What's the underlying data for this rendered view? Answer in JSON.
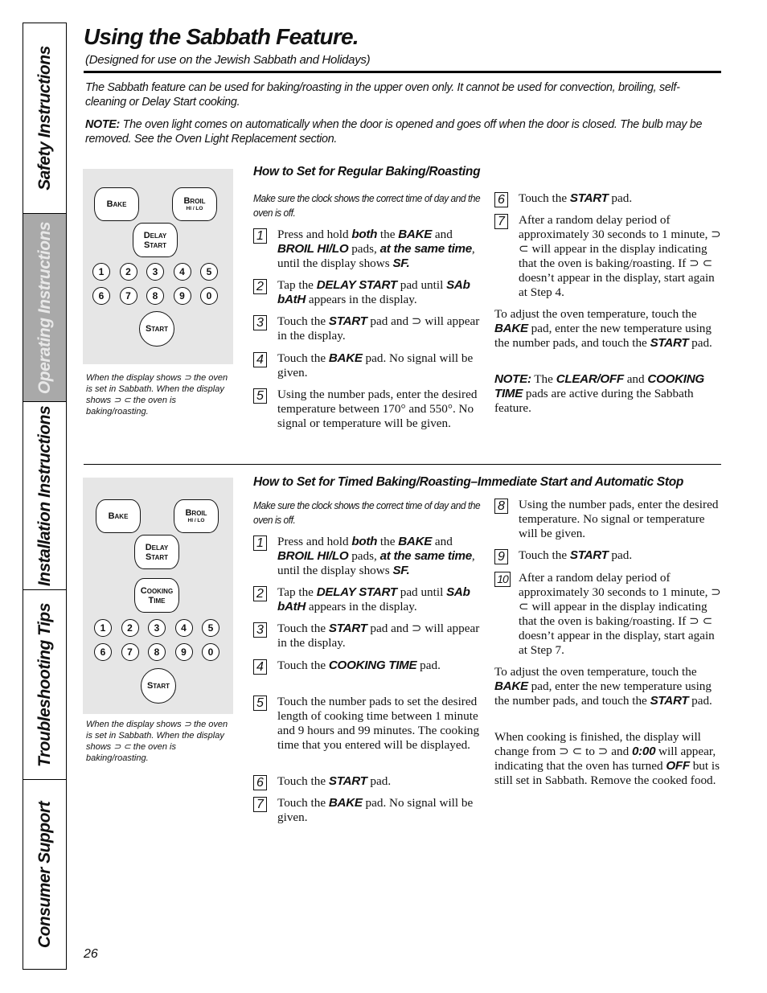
{
  "side_tabs": [
    {
      "label": "Safety Instructions",
      "active": false
    },
    {
      "label": "Operating Instructions",
      "active": true
    },
    {
      "label": "Installation Instructions",
      "active": false
    },
    {
      "label": "Troubleshooting Tips",
      "active": false
    },
    {
      "label": "Consumer Support",
      "active": false
    }
  ],
  "header": {
    "title": "Using the Sabbath Feature.",
    "subtitle": "(Designed for use on the Jewish Sabbath and Holidays)"
  },
  "intro": {
    "p1": "The Sabbath feature can be used for baking/roasting in the upper oven only. It cannot be used for convection, broiling, self-cleaning or Delay Start cooking.",
    "note_label": "NOTE:",
    "note_text": " The oven light comes on automatically when the door is opened and goes off when the door is closed. The bulb may be removed. See the Oven Light Replacement section."
  },
  "keypad": {
    "bake": "Bake",
    "broil": "Broil",
    "broil_sub": "HI / LO",
    "delay1": "Delay",
    "delay2": "Start",
    "cooking1": "Cooking",
    "cooking2": "Time",
    "numbers": [
      "1",
      "2",
      "3",
      "4",
      "5",
      "6",
      "7",
      "8",
      "9",
      "0"
    ],
    "start": "Start",
    "caption": "When the display shows ⊃ the oven is set in Sabbath. When the display shows ⊃ ⊂  the oven is baking/roasting."
  },
  "section1": {
    "heading": "How to Set for Regular Baking/Roasting",
    "pre": "Make sure the clock shows the correct time of day and the oven is off.",
    "steps": [
      {
        "n": "1",
        "html": "Press and hold <b class='bi'>both</b> the <b class='bi'>BAKE</b> and <b class='bi'>BROIL HI/LO</b> pads, <b class='bi'>at the same time</b>, until the display shows <b class='bi'>SF.</b>"
      },
      {
        "n": "2",
        "html": "Tap the <b class='bi'>DELAY START</b> pad until <b class='bi'>SAb bAtH</b> appears in the display."
      },
      {
        "n": "3",
        "html": "Touch the <b class='bi'>START</b> pad and ⊃ will appear in the display."
      },
      {
        "n": "4",
        "html": "Touch the <b class='bi'>BAKE</b> pad. No signal will be given."
      },
      {
        "n": "5",
        "html": "Using the number pads, enter the desired temperature between 170° and 550°. No signal or temperature will be given."
      },
      {
        "n": "6",
        "html": "Touch the <b class='bi'>START</b> pad."
      },
      {
        "n": "7",
        "html": "After a random delay period of approximately 30 seconds to 1 minute, ⊃ ⊂ will appear in the display indicating that the oven is baking/roasting. If ⊃ ⊂  doesn’t appear in the display, start again at Step 4."
      }
    ],
    "adjust": "To adjust the oven temperature, touch the <b class='bi'>BAKE</b> pad, enter the new temperature using the number pads, and touch the <b class='bi'>START</b> pad.",
    "note": "<b class='bi'>NOTE:</b> The <b class='bi'>CLEAR/OFF</b> and <b class='bi'>COOKING TIME</b> pads are active during the Sabbath feature."
  },
  "section2": {
    "heading": "How to Set for Timed Baking/Roasting–Immediate Start and Automatic Stop",
    "pre": "Make sure the clock shows the correct time of day and the oven is off.",
    "steps": [
      {
        "n": "1",
        "html": "Press and hold <b class='bi'>both</b> the <b class='bi'>BAKE</b> and <b class='bi'>BROIL HI/LO</b> pads, <b class='bi'>at the same time</b>, until the display shows <b class='bi'>SF.</b>"
      },
      {
        "n": "2",
        "html": "Tap the <b class='bi'>DELAY START</b> pad until <b class='bi'>SAb bAtH</b> appears in the display."
      },
      {
        "n": "3",
        "html": "Touch the <b class='bi'>START</b> pad and ⊃ will appear in the display."
      },
      {
        "n": "4",
        "html": "Touch the <b class='bi'>COOKING TIME</b> pad."
      },
      {
        "n": "5",
        "html": "Touch the number pads to set the desired length of cooking time between 1 minute and 9 hours and 99 minutes. The cooking time that you entered will be displayed."
      },
      {
        "n": "6",
        "html": "Touch the <b class='bi'>START</b> pad."
      },
      {
        "n": "7",
        "html": "Touch the <b class='bi'>BAKE</b> pad. No signal will be given."
      },
      {
        "n": "8",
        "html": "Using the number pads, enter the desired temperature. No signal or temperature will be given."
      },
      {
        "n": "9",
        "html": "Touch the <b class='bi'>START</b> pad."
      },
      {
        "n": "10",
        "html": "After a random delay period of approximately 30 seconds to 1 minute, ⊃ ⊂ will appear in the display indicating that the oven is baking/roasting. If ⊃ ⊂  doesn’t appear in the display, start again at Step 7."
      }
    ],
    "adjust": "To adjust the oven temperature, touch the <b class='bi'>BAKE</b> pad, enter the new temperature using the number pads, and touch the <b class='bi'>START</b> pad.",
    "finish": "When cooking is finished, the display will change from ⊃ ⊂ to ⊃ and <b class='bi'>0:00</b> will appear, indicating that the oven has turned <b class='bi'>OFF</b> but is still set in Sabbath. Remove the cooked food."
  },
  "page_number": "26"
}
